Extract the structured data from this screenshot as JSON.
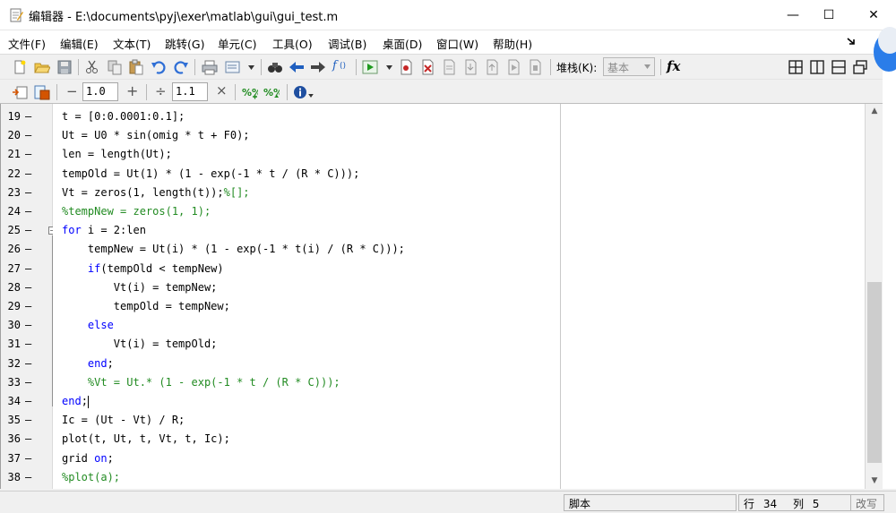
{
  "window": {
    "title": "编辑器 - E:\\documents\\pyj\\exer\\matlab\\gui\\gui_test.m",
    "minimize_glyph": "—",
    "maximize_glyph": "☐",
    "close_glyph": "✕"
  },
  "menu": [
    "文件(F)",
    "编辑(E)",
    "文本(T)",
    "跳转(G)",
    "单元(C)",
    "工具(O)",
    "调试(B)",
    "桌面(D)",
    "窗口(W)",
    "帮助(H)"
  ],
  "toolbar": {
    "stack_label": "堆栈(K):",
    "stack_value": "基本",
    "fx_label": "fx"
  },
  "cell_toolbar": {
    "minus": "−",
    "value1": "1.0",
    "plus": "+",
    "divide": "÷",
    "value2": "1.1",
    "times": "×"
  },
  "editor": {
    "lines": [
      {
        "n": "19",
        "segs": [
          {
            "t": "t = [0:0.0001:0.1];",
            "c": ""
          }
        ]
      },
      {
        "n": "20",
        "segs": [
          {
            "t": "Ut = U0 * sin(omig * t + F0);",
            "c": ""
          }
        ]
      },
      {
        "n": "21",
        "segs": [
          {
            "t": "len = length(Ut);",
            "c": ""
          }
        ]
      },
      {
        "n": "22",
        "segs": [
          {
            "t": "tempOld = Ut(1) * (1 - exp(-1 * t / (R * C)));",
            "c": ""
          }
        ]
      },
      {
        "n": "23",
        "segs": [
          {
            "t": "Vt = zeros(1, length(t));",
            "c": ""
          },
          {
            "t": "%[];",
            "c": "cm"
          }
        ]
      },
      {
        "n": "24",
        "segs": [
          {
            "t": "%tempNew = zeros(1, 1);",
            "c": "cm"
          }
        ]
      },
      {
        "n": "25",
        "segs": [
          {
            "t": "for",
            "c": "kw"
          },
          {
            "t": " i = 2:len",
            "c": ""
          }
        ]
      },
      {
        "n": "26",
        "segs": [
          {
            "t": "    tempNew = Ut(i) * (1 - exp(-1 * t(i) / (R * C)));",
            "c": ""
          }
        ]
      },
      {
        "n": "27",
        "segs": [
          {
            "t": "    ",
            "c": ""
          },
          {
            "t": "if",
            "c": "kw"
          },
          {
            "t": "(tempOld < tempNew)",
            "c": ""
          }
        ]
      },
      {
        "n": "28",
        "segs": [
          {
            "t": "        Vt(i) = tempNew;",
            "c": ""
          }
        ]
      },
      {
        "n": "29",
        "segs": [
          {
            "t": "        tempOld = tempNew;",
            "c": ""
          }
        ]
      },
      {
        "n": "30",
        "segs": [
          {
            "t": "    ",
            "c": ""
          },
          {
            "t": "else",
            "c": "kw"
          }
        ]
      },
      {
        "n": "31",
        "segs": [
          {
            "t": "        Vt(i) = tempOld;",
            "c": ""
          }
        ]
      },
      {
        "n": "32",
        "segs": [
          {
            "t": "    ",
            "c": ""
          },
          {
            "t": "end",
            "c": "kw"
          },
          {
            "t": ";",
            "c": ""
          }
        ]
      },
      {
        "n": "33",
        "segs": [
          {
            "t": "    %Vt = Ut.* (1 - exp(-1 * t / (R * C)));",
            "c": "cm"
          }
        ]
      },
      {
        "n": "34",
        "segs": [
          {
            "t": "end",
            "c": "kw"
          },
          {
            "t": ";",
            "c": ""
          }
        ],
        "cursor": true
      },
      {
        "n": "35",
        "segs": [
          {
            "t": "Ic = (Ut - Vt) / R;",
            "c": ""
          }
        ]
      },
      {
        "n": "36",
        "segs": [
          {
            "t": "plot(t, Ut, t, Vt, t, Ic);",
            "c": ""
          }
        ]
      },
      {
        "n": "37",
        "segs": [
          {
            "t": "grid ",
            "c": ""
          },
          {
            "t": "on",
            "c": "kw"
          },
          {
            "t": ";",
            "c": ""
          }
        ]
      },
      {
        "n": "38",
        "segs": [
          {
            "t": "%plot(a);",
            "c": "cm"
          }
        ]
      }
    ]
  },
  "status": {
    "mode": "脚本",
    "row_label": "行",
    "row": "34",
    "col_label": "列",
    "col": "5",
    "overwrite": "改写"
  },
  "colors": {
    "keyword": "#0000ff",
    "comment": "#228b22"
  }
}
